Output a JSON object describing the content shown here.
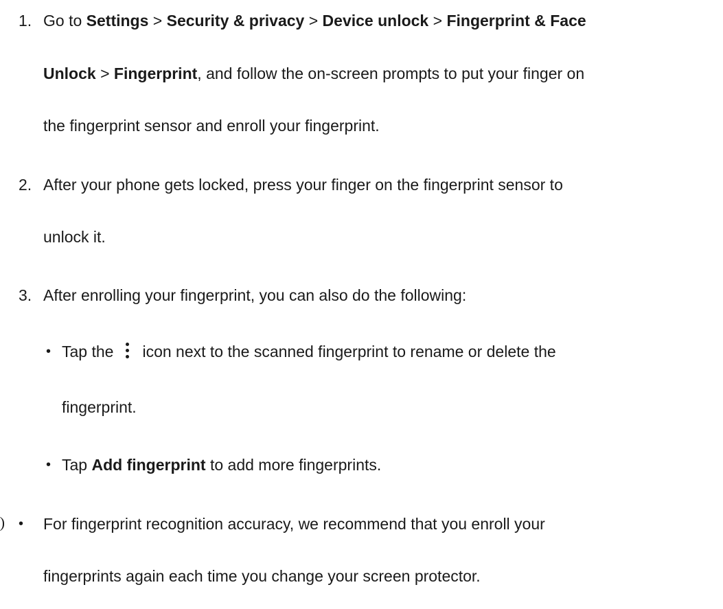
{
  "steps": [
    {
      "number": "1.",
      "line1": {
        "t1": "Go to ",
        "b1": "Settings",
        "t2": " > ",
        "b2": "Security & privacy",
        "t3": " > ",
        "b3": "Device unlock",
        "t4": " > ",
        "b4": "Fingerprint & Face"
      },
      "line2": {
        "b1": "Unlock",
        "t1": " > ",
        "b2": "Fingerprint",
        "t2": ", and follow the on-screen prompts to put your finger on"
      },
      "line3": "the fingerprint sensor and enroll your fingerprint."
    },
    {
      "number": "2.",
      "line1": "After your phone gets locked, press your finger on the fingerprint sensor to",
      "line2": "unlock it."
    },
    {
      "number": "3.",
      "line1": "After enrolling your fingerprint, you can also do the following:"
    }
  ],
  "sub_bullets": [
    {
      "bullet": "•",
      "line1_before_icon": "Tap the",
      "icon": "more-vertical-icon",
      "line1_after_icon": "icon next to the scanned fingerprint to rename or delete the",
      "line2": "fingerprint."
    },
    {
      "bullet": "•",
      "t1": "Tap ",
      "b1": "Add fingerprint",
      "t2": " to add more fingerprints."
    }
  ],
  "note": {
    "bullet": "•",
    "line1": "For fingerprint recognition accuracy, we recommend that you enroll your",
    "line2": "fingerprints again each time you change your screen protector."
  }
}
